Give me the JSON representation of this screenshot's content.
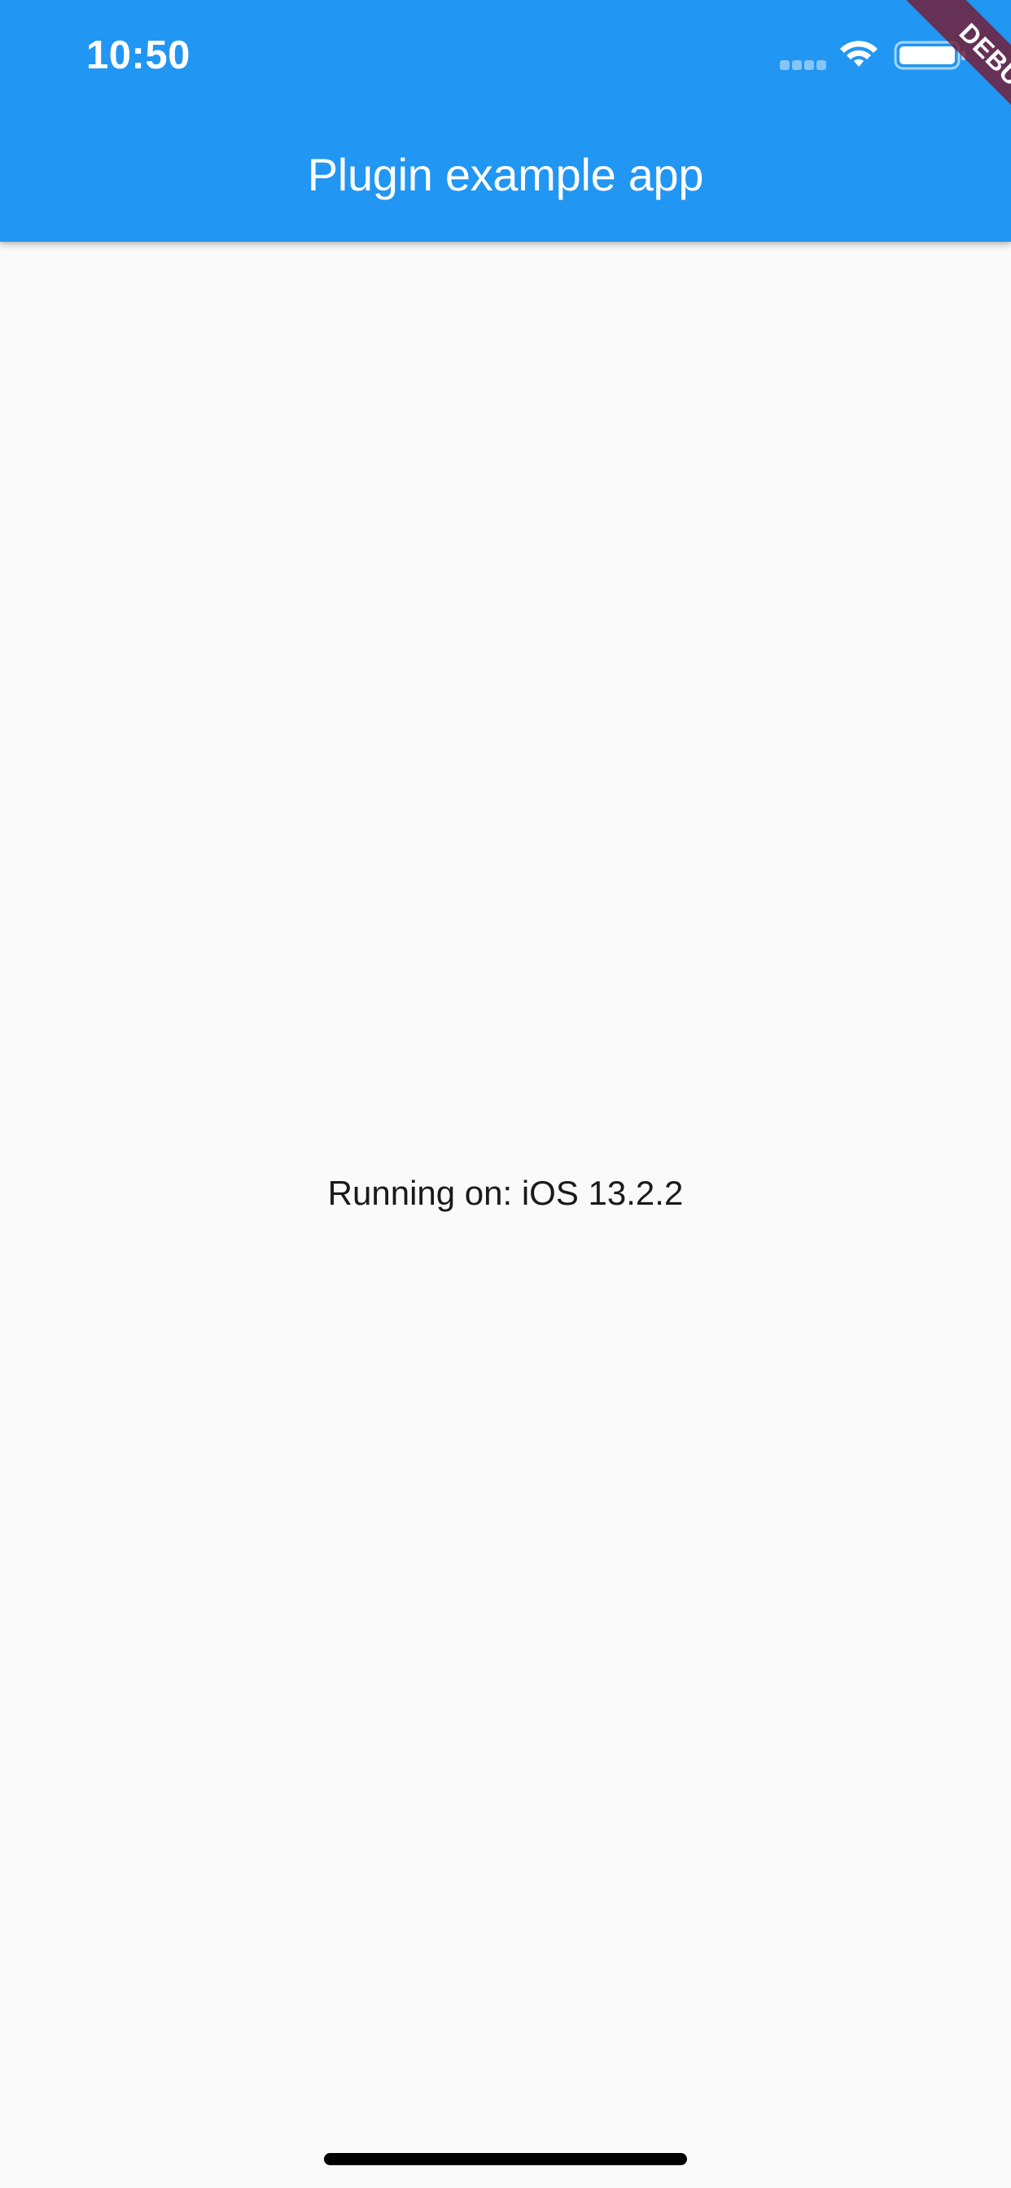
{
  "status_bar": {
    "time": "10:50",
    "icons": [
      "cellular-signal-icon",
      "wifi-icon",
      "battery-icon"
    ]
  },
  "app_bar": {
    "title": "Plugin example app",
    "background_color": "#2196f3"
  },
  "debug_banner": {
    "label": "DEBUG"
  },
  "body": {
    "platform_text": "Running on: iOS 13.2.2"
  },
  "colors": {
    "accent": "#2196f3",
    "background": "#fafafa",
    "text": "#1a1a1a"
  }
}
